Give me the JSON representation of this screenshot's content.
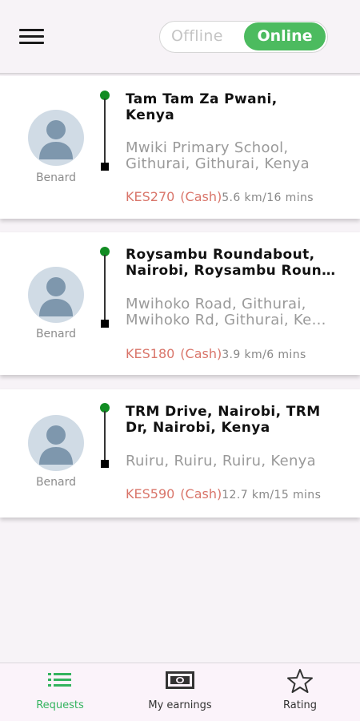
{
  "header": {
    "menu_icon": "hamburger-menu-icon",
    "toggle": {
      "offline_label": "Offline",
      "online_label": "Online",
      "selected": "Online"
    }
  },
  "colors": {
    "accent": "#4cbb5f",
    "fare": "#d9756a",
    "pickup_dot": "#118c22",
    "active_nav": "#33b35e"
  },
  "requests": [
    {
      "rider": "Benard",
      "pickup": "Tam Tam Za Pwani,\nKenya",
      "dropoff": "Mwiki Primary School,\nGithurai, Githurai, Kenya",
      "fare": "KES270",
      "payment": "(Cash)",
      "distance": "5.6 km/16 mins"
    },
    {
      "rider": "Benard",
      "pickup": "Roysambu Roundabout,\nNairobi, Roysambu Roun…",
      "dropoff": "Mwihoko Road, Githurai,\nMwihoko Rd, Githurai, Ke…",
      "fare": "KES180",
      "payment": "(Cash)",
      "distance": "3.9 km/6 mins"
    },
    {
      "rider": "Benard",
      "pickup": "TRM Drive, Nairobi, TRM\nDr, Nairobi, Kenya",
      "dropoff": "Ruiru, Ruiru, Ruiru, Kenya",
      "fare": "KES590",
      "payment": "(Cash)",
      "distance": "12.7 km/15 mins"
    }
  ],
  "bottom_nav": [
    {
      "label": "Requests",
      "icon": "list-icon",
      "active": true
    },
    {
      "label": "My earnings",
      "icon": "cash-icon",
      "active": false
    },
    {
      "label": "Rating",
      "icon": "star-icon",
      "active": false
    }
  ]
}
